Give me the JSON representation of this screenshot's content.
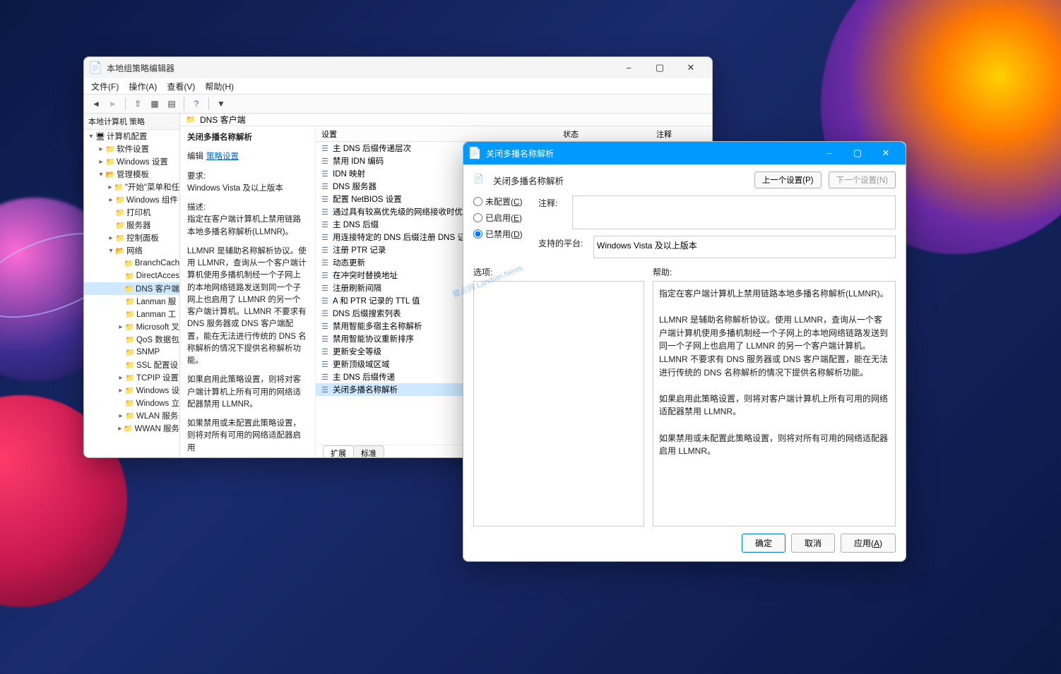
{
  "watermark": "蒙点网 Landian.News",
  "gpedit": {
    "title": "本地组策略编辑器",
    "menus": {
      "file": "文件(F)",
      "action": "操作(A)",
      "view": "查看(V)",
      "help": "帮助(H)"
    },
    "tree_header": "本地计算机 策略",
    "tree": {
      "root": "计算机配置",
      "soft": "软件设置",
      "win": "Windows 设置",
      "adm": "管理模板",
      "start": "\"开始\"菜单和任",
      "comp": "Windows 组件",
      "printer": "打印机",
      "server": "服务器",
      "cpanel": "控制面板",
      "net": "网络",
      "branch": "BranchCach",
      "direct": "DirectAcces",
      "dns": "DNS 客户端",
      "lanman": "Lanman 服",
      "lanmanw": "Lanman 工",
      "ms": "Microsoft 叉",
      "qos": "QoS 数据包",
      "snmp": "SNMP",
      "ssl": "SSL 配置设",
      "tcpip": "TCPIP 设置",
      "winset": "Windows 设",
      "winup": "Windows 立",
      "wlan": "WLAN 服务",
      "wwan": "WWAN 服务"
    },
    "path_label": "DNS 客户端",
    "detail": {
      "title": "关闭多播名称解析",
      "edit_prefix": "编辑",
      "edit_link": "策略设置",
      "req_label": "要求:",
      "req_value": "Windows Vista 及以上版本",
      "desc_label": "描述:",
      "desc_p1": "指定在客户端计算机上禁用链路本地多播名称解析(LLMNR)。",
      "desc_p2": "LLMNR 是辅助名称解析协议。使用 LLMNR，查询从一个客户端计算机使用多播机制经一个子网上的本地网络链路发送到同一个子网上也启用了 LLMNR 的另一个客户端计算机。LLMNR 不要求有 DNS 服务器或 DNS 客户端配置，能在无法进行传统的 DNS 名称解析的情况下提供名称解析功能。",
      "desc_p3": "如果启用此策略设置，则将对客户端计算机上所有可用的网络适配器禁用 LLMNR。",
      "desc_p4": "如果禁用或未配置此策略设置，则将对所有可用的网络适配器启用"
    },
    "columns": {
      "setting": "设置",
      "state": "状态",
      "comment": "注释"
    },
    "settings_list": [
      "主 DNS 后缀传递层次",
      "禁用 IDN 编码",
      "IDN 映射",
      "DNS 服务器",
      "配置 NetBIOS 设置",
      "通过具有较高优先级的网络接收时优",
      "主 DNS 后缀",
      "用连接特定的 DNS 后缀注册 DNS 证",
      "注册 PTR 记录",
      "动态更新",
      "在冲突时替换地址",
      "注册刷新间隔",
      "A 和 PTR 记录的 TTL 值",
      "DNS 后缀搜索列表",
      "禁用智能多宿主名称解析",
      "禁用智能协议重新排序",
      "更新安全等级",
      "更新顶级域区域",
      "主 DNS 后缀传递",
      "关闭多播名称解析"
    ],
    "selected_setting_index": 19,
    "tabs": {
      "extended": "扩展",
      "standard": "标准"
    }
  },
  "dialog": {
    "title": "关闭多播名称解析",
    "heading": "关闭多播名称解析",
    "prev": "上一个设置(P)",
    "next": "下一个设置(N)",
    "radio_notconfig": "未配置(C)",
    "radio_enabled": "已启用(E)",
    "radio_disabled": "已禁用(D)",
    "selected_radio": "disabled",
    "comment_label": "注释:",
    "platform_label": "支持的平台:",
    "platform_value": "Windows Vista 及以上版本",
    "options_label": "选项:",
    "help_label": "帮助:",
    "help_text": "指定在客户端计算机上禁用链路本地多播名称解析(LLMNR)。\n\nLLMNR 是辅助名称解析协议。使用 LLMNR，查询从一个客户端计算机使用多播机制经一个子网上的本地网络链路发送到同一个子网上也启用了 LLMNR 的另一个客户端计算机。LLMNR 不要求有 DNS 服务器或 DNS 客户端配置，能在无法进行传统的 DNS 名称解析的情况下提供名称解析功能。\n\n如果启用此策略设置，则将对客户端计算机上所有可用的网络适配器禁用 LLMNR。\n\n如果禁用或未配置此策略设置，则将对所有可用的网络适配器启用 LLMNR。",
    "ok": "确定",
    "cancel": "取消",
    "apply": "应用(A)"
  }
}
